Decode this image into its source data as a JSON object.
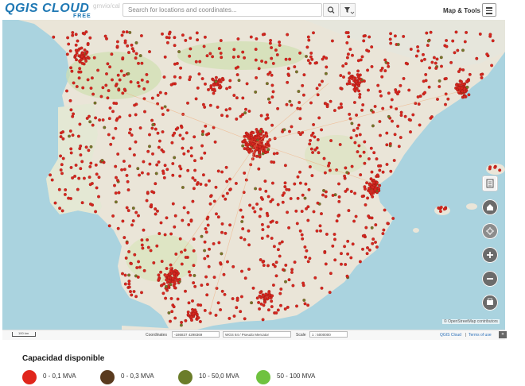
{
  "app": {
    "logo_text": "QGIS CLOUD",
    "logo_badge": "FREE",
    "logo_subtext": "gmvio/cal"
  },
  "search": {
    "placeholder": "Search for locations and coordinates...",
    "value": "",
    "search_icon": "search-icon",
    "filter_icon": "filter-dropdown-icon"
  },
  "toolbar": {
    "map_tools_label": "Map & Tools",
    "menu_icon": "hamburger-menu-icon"
  },
  "map": {
    "basemap": "OpenStreetMap",
    "points_color": "#d7261e",
    "secondary_points_color": "#6b7d2a",
    "controls": [
      {
        "name": "layers-icon"
      },
      {
        "name": "home-icon"
      },
      {
        "name": "locate-icon"
      },
      {
        "name": "zoom-in-icon"
      },
      {
        "name": "zoom-out-icon"
      },
      {
        "name": "print-icon"
      }
    ],
    "attribution": "© OpenStreetMap contributors"
  },
  "footer": {
    "scale_bar_label": "100 km",
    "coordinates_label": "Coordinates",
    "coordinates_value": "-186837 4298369",
    "crs_value": "WGS 84 / Pseudo Mercator",
    "scale_label": "Scale",
    "scale_value": "1 : 5000000",
    "qgis_cloud_link": "QGIS Cloud",
    "separator": "|",
    "terms_link": "Terms of use",
    "collapse_icon": "collapse-icon"
  },
  "legend": {
    "title": "Capacidad disponible",
    "items": [
      {
        "label": "0 - 0,1 MVA",
        "color": "#e0251b"
      },
      {
        "label": "0 - 0,3 MVA",
        "color": "#5a3b1f"
      },
      {
        "label": "10 - 50,0 MVA",
        "color": "#6b7d2a"
      },
      {
        "label": "50 - 100 MVA",
        "color": "#6fc23f"
      }
    ]
  }
}
